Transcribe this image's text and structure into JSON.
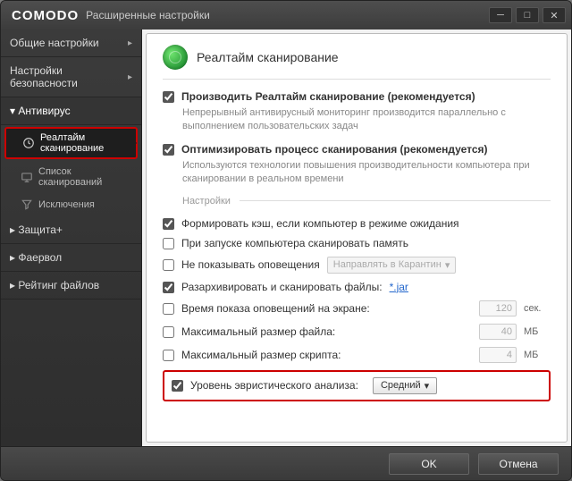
{
  "titlebar": {
    "logo": "COMODO",
    "subtitle": "Расширенные настройки"
  },
  "sidebar": {
    "general": "Общие настройки",
    "security": "Настройки безопасности",
    "antivirus": "Антивирус",
    "av_items": {
      "realtime": "Реалтайм сканирование",
      "scanlist": "Список сканирований",
      "exclusions": "Исключения"
    },
    "defense": "Защита+",
    "firewall": "Фаервол",
    "rating": "Рейтинг файлов"
  },
  "panel": {
    "title": "Реалтайм сканирование",
    "opt_realtime": {
      "label": "Производить Реалтайм сканирование (рекомендуется)",
      "desc": "Непрерывный антивирусный мониторинг производится параллельно с выполнением пользовательских задач"
    },
    "opt_optimize": {
      "label": "Оптимизировать процесс сканирования (рекомендуется)",
      "desc": "Используются технологии повышения производительности компьютера при сканировании в реальном времени"
    },
    "settings_label": "Настройки",
    "cache": "Формировать кэш, если компьютер в режиме ожидания",
    "scan_memory": "При запуске компьютера сканировать память",
    "hide_alerts": "Не показывать оповещения",
    "quarantine_action": "Направлять в Карантин",
    "scan_archives": "Разархивировать и сканировать файлы:",
    "jar_link": "*.jar",
    "alert_time": "Время показа оповещений на экране:",
    "alert_time_val": "120",
    "alert_time_unit": "сек.",
    "max_file": "Максимальный размер файла:",
    "max_file_val": "40",
    "max_file_unit": "МБ",
    "max_script": "Максимальный размер скрипта:",
    "max_script_val": "4",
    "max_script_unit": "МБ",
    "heur": "Уровень эвристического анализа:",
    "heur_val": "Средний"
  },
  "footer": {
    "ok": "OK",
    "cancel": "Отмена"
  }
}
